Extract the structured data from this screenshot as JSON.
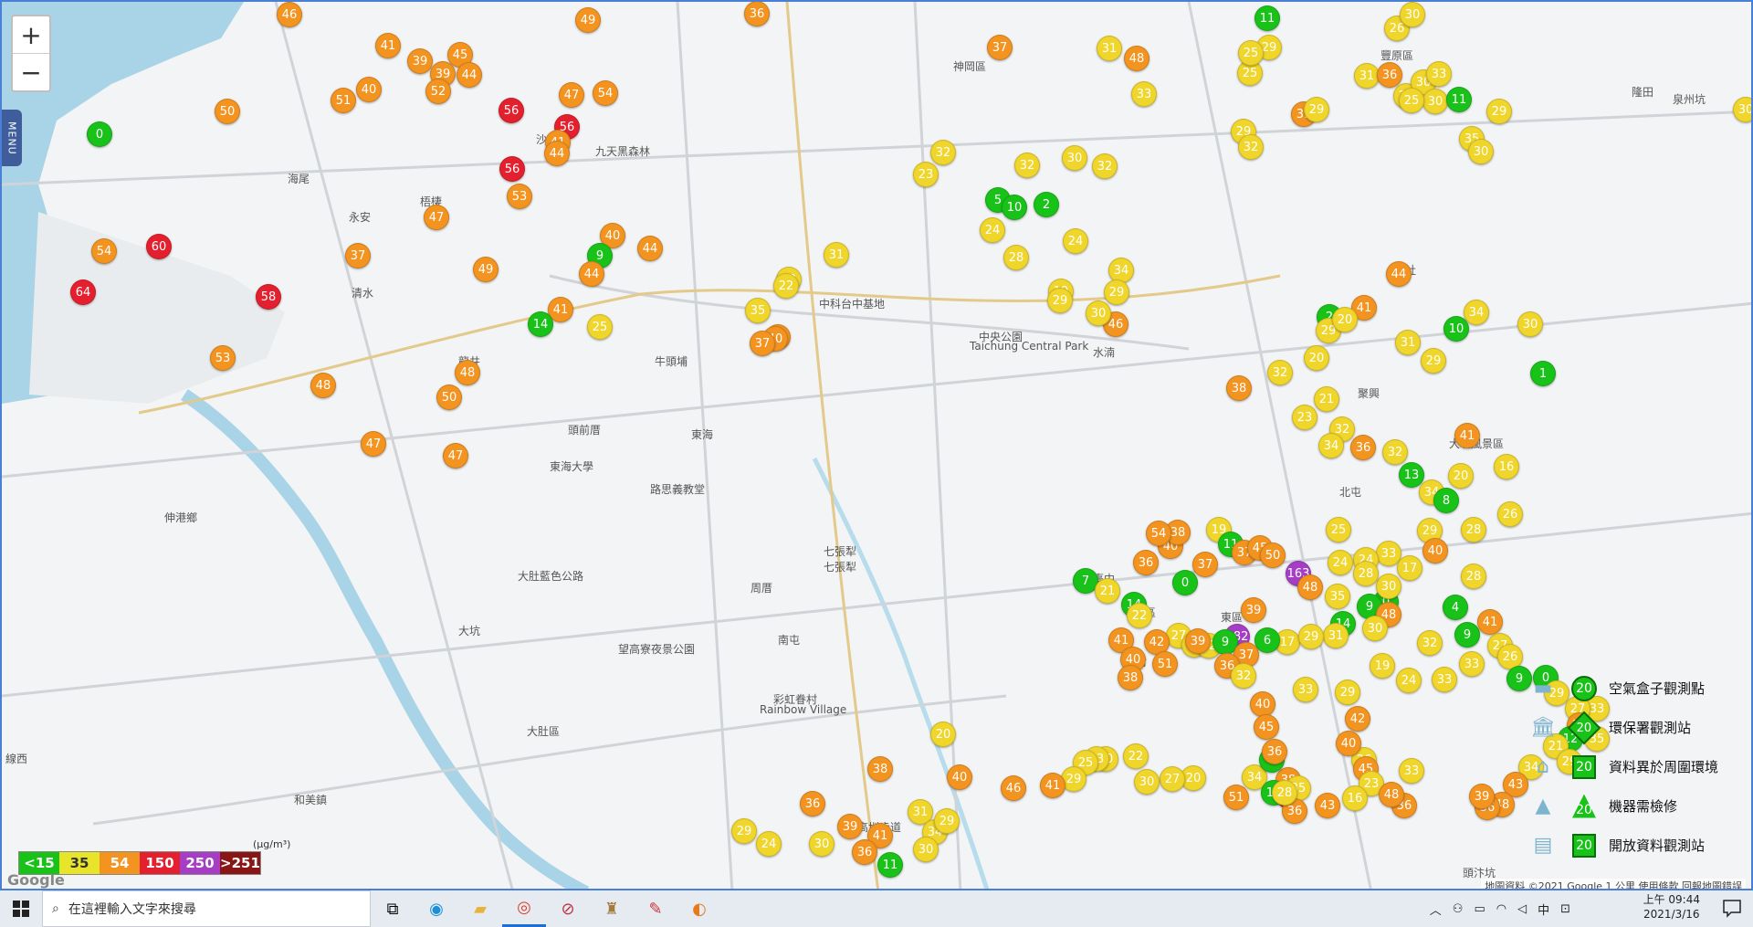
{
  "map": {
    "zoom_in": "+",
    "zoom_out": "−",
    "menu_label": "MENU",
    "places": [
      {
        "name": "沙鹿區"
      },
      {
        "name": "九天黑森林"
      },
      {
        "name": "神岡區"
      },
      {
        "name": "豐原區"
      },
      {
        "name": "梧棲"
      },
      {
        "name": "海尾"
      },
      {
        "name": "永安"
      },
      {
        "name": "清水"
      },
      {
        "name": "龍井"
      },
      {
        "name": "牛頭埔"
      },
      {
        "name": "中科台中基地"
      },
      {
        "name": "中央公園"
      },
      {
        "name": "Taichung Central Park"
      },
      {
        "name": "水湳"
      },
      {
        "name": "北屯"
      },
      {
        "name": "大坑風景區"
      },
      {
        "name": "頭前厝"
      },
      {
        "name": "東海"
      },
      {
        "name": "南屯"
      },
      {
        "name": "路思義教堂"
      },
      {
        "name": "大肚區"
      },
      {
        "name": "伸港鄉"
      },
      {
        "name": "彩虹眷村"
      },
      {
        "name": "Rainbow Village"
      },
      {
        "name": "知高圳步道"
      },
      {
        "name": "望高寮夜景公園"
      },
      {
        "name": "大肚藍色公路"
      },
      {
        "name": "周厝"
      },
      {
        "name": "七張犁"
      },
      {
        "name": "臺中"
      },
      {
        "name": "北區"
      },
      {
        "name": "中市"
      },
      {
        "name": "東區"
      },
      {
        "name": "頭汴坑"
      },
      {
        "name": "線西"
      },
      {
        "name": "和美鎮"
      },
      {
        "name": "大坑"
      },
      {
        "name": "新社"
      },
      {
        "name": "聚興"
      },
      {
        "name": "隆田"
      },
      {
        "name": "泉州坑"
      },
      {
        "name": "東海大學"
      },
      {
        "name": "七張犁"
      }
    ]
  },
  "legend": {
    "scale": [
      {
        "label": "<15",
        "color": "#19c219"
      },
      {
        "label": "35",
        "color": "#e7e42a"
      },
      {
        "label": "54",
        "color": "#f39320"
      },
      {
        "label": "150",
        "color": "#e5202e"
      },
      {
        "label": "250",
        "color": "#a63ec5"
      },
      {
        "label": ">251",
        "color": "#8a1515"
      }
    ],
    "unit": "(μg/m³)",
    "types": [
      {
        "label": "空氣盒子觀測點",
        "shape": "circle",
        "value": "20"
      },
      {
        "label": "環保署觀測站",
        "shape": "diamond",
        "value": "20"
      },
      {
        "label": "資料異於周圍環境",
        "shape": "square",
        "value": "20"
      },
      {
        "label": "機器需檢修",
        "shape": "triangle",
        "value": "20"
      },
      {
        "label": "開放資料觀測站",
        "shape": "square",
        "value": "20"
      }
    ]
  },
  "attribution": "地圖資料 ©2021 Google   1 公里   使用條款   回報地圖錯誤",
  "google_logo": "Google",
  "colors": {
    "green": "#19c219",
    "yellow": "#f0d52b",
    "orange": "#f39320",
    "red": "#e5202e",
    "purple": "#a63ec5",
    "brown": "#8a1515"
  },
  "markers": [
    {
      "v": "46",
      "c": "orange"
    },
    {
      "v": "41",
      "c": "orange"
    },
    {
      "v": "39",
      "c": "orange"
    },
    {
      "v": "45",
      "c": "orange"
    },
    {
      "v": "39",
      "c": "orange"
    },
    {
      "v": "44",
      "c": "orange"
    },
    {
      "v": "49",
      "c": "orange"
    },
    {
      "v": "36",
      "c": "orange"
    },
    {
      "v": "37",
      "c": "orange"
    },
    {
      "v": "48",
      "c": "orange"
    },
    {
      "v": "25",
      "c": "yellow"
    },
    {
      "v": "29",
      "c": "yellow"
    },
    {
      "v": "11",
      "c": "green"
    },
    {
      "v": "26",
      "c": "yellow"
    },
    {
      "v": "30",
      "c": "yellow"
    },
    {
      "v": "51",
      "c": "orange"
    },
    {
      "v": "40",
      "c": "orange"
    },
    {
      "v": "52",
      "c": "orange"
    },
    {
      "v": "50",
      "c": "orange"
    },
    {
      "v": "0",
      "c": "green"
    },
    {
      "v": "56",
      "c": "red"
    },
    {
      "v": "56",
      "c": "red"
    },
    {
      "v": "47",
      "c": "orange"
    },
    {
      "v": "54",
      "c": "orange"
    },
    {
      "v": "41",
      "c": "orange"
    },
    {
      "v": "56",
      "c": "red"
    },
    {
      "v": "53",
      "c": "orange"
    },
    {
      "v": "44",
      "c": "orange"
    },
    {
      "v": "47",
      "c": "orange"
    },
    {
      "v": "54",
      "c": "orange"
    },
    {
      "v": "60",
      "c": "red"
    },
    {
      "v": "37",
      "c": "orange"
    },
    {
      "v": "49",
      "c": "orange"
    },
    {
      "v": "64",
      "c": "red"
    },
    {
      "v": "58",
      "c": "red"
    },
    {
      "v": "53",
      "c": "orange"
    },
    {
      "v": "48",
      "c": "orange"
    },
    {
      "v": "50",
      "c": "orange"
    },
    {
      "v": "48",
      "c": "orange"
    },
    {
      "v": "47",
      "c": "orange"
    },
    {
      "v": "47",
      "c": "orange"
    },
    {
      "v": "41",
      "c": "orange"
    },
    {
      "v": "14",
      "c": "green"
    },
    {
      "v": "25",
      "c": "yellow"
    },
    {
      "v": "40",
      "c": "orange"
    },
    {
      "v": "44",
      "c": "orange"
    },
    {
      "v": "9",
      "c": "green"
    },
    {
      "v": "44",
      "c": "orange"
    },
    {
      "v": "22",
      "c": "yellow"
    },
    {
      "v": "31",
      "c": "yellow"
    },
    {
      "v": "22",
      "c": "yellow"
    },
    {
      "v": "40",
      "c": "orange"
    },
    {
      "v": "35",
      "c": "yellow"
    },
    {
      "v": "40",
      "c": "orange"
    },
    {
      "v": "37",
      "c": "orange"
    },
    {
      "v": "32",
      "c": "yellow"
    },
    {
      "v": "23",
      "c": "yellow"
    },
    {
      "v": "32",
      "c": "yellow"
    },
    {
      "v": "30",
      "c": "yellow"
    },
    {
      "v": "32",
      "c": "yellow"
    },
    {
      "v": "5",
      "c": "green"
    },
    {
      "v": "10",
      "c": "green"
    },
    {
      "v": "2",
      "c": "green"
    },
    {
      "v": "24",
      "c": "yellow"
    },
    {
      "v": "28",
      "c": "yellow"
    },
    {
      "v": "24",
      "c": "yellow"
    },
    {
      "v": "34",
      "c": "yellow"
    },
    {
      "v": "29",
      "c": "yellow"
    },
    {
      "v": "46",
      "c": "orange"
    },
    {
      "v": "19",
      "c": "yellow"
    },
    {
      "v": "29",
      "c": "yellow"
    },
    {
      "v": "30",
      "c": "yellow"
    },
    {
      "v": "31",
      "c": "yellow"
    },
    {
      "v": "33",
      "c": "yellow"
    },
    {
      "v": "25",
      "c": "yellow"
    },
    {
      "v": "29",
      "c": "yellow"
    },
    {
      "v": "32",
      "c": "yellow"
    },
    {
      "v": "39",
      "c": "orange"
    },
    {
      "v": "31",
      "c": "yellow"
    },
    {
      "v": "29",
      "c": "yellow"
    },
    {
      "v": "36",
      "c": "orange"
    },
    {
      "v": "29",
      "c": "yellow"
    },
    {
      "v": "30",
      "c": "yellow"
    },
    {
      "v": "33",
      "c": "yellow"
    },
    {
      "v": "30",
      "c": "yellow"
    },
    {
      "v": "25",
      "c": "yellow"
    },
    {
      "v": "2",
      "c": "green"
    },
    {
      "v": "29",
      "c": "yellow"
    },
    {
      "v": "20",
      "c": "yellow"
    },
    {
      "v": "31",
      "c": "yellow"
    },
    {
      "v": "34",
      "c": "yellow"
    },
    {
      "v": "10",
      "c": "green"
    },
    {
      "v": "30",
      "c": "yellow"
    },
    {
      "v": "30",
      "c": "yellow"
    },
    {
      "v": "35",
      "c": "yellow"
    },
    {
      "v": "30",
      "c": "yellow"
    },
    {
      "v": "29",
      "c": "yellow"
    },
    {
      "v": "11",
      "c": "green"
    },
    {
      "v": "1",
      "c": "green"
    },
    {
      "v": "29",
      "c": "yellow"
    },
    {
      "v": "41",
      "c": "orange"
    },
    {
      "v": "44",
      "c": "orange"
    },
    {
      "v": "41",
      "c": "orange"
    },
    {
      "v": "20",
      "c": "yellow"
    },
    {
      "v": "32",
      "c": "yellow"
    },
    {
      "v": "38",
      "c": "orange"
    },
    {
      "v": "23",
      "c": "yellow"
    },
    {
      "v": "21",
      "c": "yellow"
    },
    {
      "v": "32",
      "c": "yellow"
    },
    {
      "v": "34",
      "c": "yellow"
    },
    {
      "v": "36",
      "c": "orange"
    },
    {
      "v": "32",
      "c": "yellow"
    },
    {
      "v": "13",
      "c": "green"
    },
    {
      "v": "20",
      "c": "yellow"
    },
    {
      "v": "16",
      "c": "yellow"
    },
    {
      "v": "34",
      "c": "yellow"
    },
    {
      "v": "8",
      "c": "green"
    },
    {
      "v": "29",
      "c": "yellow"
    },
    {
      "v": "28",
      "c": "yellow"
    },
    {
      "v": "26",
      "c": "yellow"
    },
    {
      "v": "33",
      "c": "yellow"
    },
    {
      "v": "40",
      "c": "orange"
    },
    {
      "v": "17",
      "c": "yellow"
    },
    {
      "v": "0",
      "c": "green"
    },
    {
      "v": "28",
      "c": "yellow"
    },
    {
      "v": "30",
      "c": "yellow"
    },
    {
      "v": "25",
      "c": "yellow"
    },
    {
      "v": "24",
      "c": "yellow"
    },
    {
      "v": "28",
      "c": "yellow"
    },
    {
      "v": "9",
      "c": "green"
    },
    {
      "v": "48",
      "c": "orange"
    },
    {
      "v": "35",
      "c": "yellow"
    },
    {
      "v": "14",
      "c": "green"
    },
    {
      "v": "31",
      "c": "yellow"
    },
    {
      "v": "30",
      "c": "yellow"
    },
    {
      "v": "17",
      "c": "yellow"
    },
    {
      "v": "19",
      "c": "yellow"
    },
    {
      "v": "24",
      "c": "yellow"
    },
    {
      "v": "33",
      "c": "yellow"
    },
    {
      "v": "9",
      "c": "green"
    },
    {
      "v": "41",
      "c": "orange"
    },
    {
      "v": "27",
      "c": "yellow"
    },
    {
      "v": "33",
      "c": "yellow"
    },
    {
      "v": "32",
      "c": "yellow"
    },
    {
      "v": "4",
      "c": "green"
    },
    {
      "v": "26",
      "c": "yellow"
    },
    {
      "v": "9",
      "c": "green"
    },
    {
      "v": "0",
      "c": "green"
    },
    {
      "v": "29",
      "c": "yellow"
    },
    {
      "v": "33",
      "c": "yellow"
    },
    {
      "v": "27",
      "c": "yellow"
    },
    {
      "v": "38",
      "c": "orange"
    },
    {
      "v": "12",
      "c": "green"
    },
    {
      "v": "21",
      "c": "yellow"
    },
    {
      "v": "35",
      "c": "yellow"
    },
    {
      "v": "29",
      "c": "yellow"
    },
    {
      "v": "34",
      "c": "yellow"
    },
    {
      "v": "43",
      "c": "orange"
    },
    {
      "v": "48",
      "c": "orange"
    },
    {
      "v": "36",
      "c": "orange"
    },
    {
      "v": "39",
      "c": "orange"
    },
    {
      "v": "36",
      "c": "orange"
    },
    {
      "v": "33",
      "c": "yellow"
    },
    {
      "v": "26",
      "c": "yellow"
    },
    {
      "v": "60",
      "c": "red"
    },
    {
      "v": "38",
      "c": "orange"
    },
    {
      "v": "34",
      "c": "yellow"
    },
    {
      "v": "8",
      "c": "green"
    },
    {
      "v": "7",
      "c": "green"
    },
    {
      "v": "21",
      "c": "yellow"
    },
    {
      "v": "14",
      "c": "green"
    },
    {
      "v": "22",
      "c": "yellow"
    },
    {
      "v": "27",
      "c": "yellow"
    },
    {
      "v": "16",
      "c": "yellow"
    },
    {
      "v": "32",
      "c": "yellow"
    },
    {
      "v": "182",
      "c": "purple"
    },
    {
      "v": "6",
      "c": "green"
    },
    {
      "v": "9",
      "c": "green"
    },
    {
      "v": "37",
      "c": "orange"
    },
    {
      "v": "36",
      "c": "orange"
    },
    {
      "v": "32",
      "c": "yellow"
    },
    {
      "v": "40",
      "c": "orange"
    },
    {
      "v": "45",
      "c": "orange"
    },
    {
      "v": "36",
      "c": "orange"
    },
    {
      "v": "13",
      "c": "green"
    },
    {
      "v": "39",
      "c": "orange"
    },
    {
      "v": "42",
      "c": "orange"
    },
    {
      "v": "41",
      "c": "orange"
    },
    {
      "v": "40",
      "c": "orange"
    },
    {
      "v": "30",
      "c": "yellow"
    },
    {
      "v": "51",
      "c": "orange"
    },
    {
      "v": "38",
      "c": "orange"
    },
    {
      "v": "39",
      "c": "orange"
    },
    {
      "v": "0",
      "c": "green"
    },
    {
      "v": "37",
      "c": "orange"
    },
    {
      "v": "40",
      "c": "orange"
    },
    {
      "v": "36",
      "c": "orange"
    },
    {
      "v": "38",
      "c": "orange"
    },
    {
      "v": "54",
      "c": "orange"
    },
    {
      "v": "19",
      "c": "yellow"
    },
    {
      "v": "11",
      "c": "green"
    },
    {
      "v": "37",
      "c": "orange"
    },
    {
      "v": "45",
      "c": "orange"
    },
    {
      "v": "50",
      "c": "orange"
    },
    {
      "v": "163",
      "c": "purple"
    },
    {
      "v": "48",
      "c": "orange"
    },
    {
      "v": "24",
      "c": "yellow"
    },
    {
      "v": "29",
      "c": "yellow"
    },
    {
      "v": "33",
      "c": "yellow"
    },
    {
      "v": "29",
      "c": "yellow"
    },
    {
      "v": "42",
      "c": "orange"
    },
    {
      "v": "40",
      "c": "orange"
    },
    {
      "v": "45",
      "c": "orange"
    },
    {
      "v": "23",
      "c": "yellow"
    },
    {
      "v": "16",
      "c": "yellow"
    },
    {
      "v": "48",
      "c": "orange"
    },
    {
      "v": "35",
      "c": "yellow"
    },
    {
      "v": "36",
      "c": "orange"
    },
    {
      "v": "43",
      "c": "orange"
    },
    {
      "v": "28",
      "c": "yellow"
    },
    {
      "v": "51",
      "c": "orange"
    },
    {
      "v": "20",
      "c": "yellow"
    },
    {
      "v": "27",
      "c": "yellow"
    },
    {
      "v": "30",
      "c": "yellow"
    },
    {
      "v": "22",
      "c": "yellow"
    },
    {
      "v": "33",
      "c": "yellow"
    },
    {
      "v": "25",
      "c": "yellow"
    },
    {
      "v": "29",
      "c": "yellow"
    },
    {
      "v": "41",
      "c": "orange"
    },
    {
      "v": "46",
      "c": "orange"
    },
    {
      "v": "40",
      "c": "orange"
    },
    {
      "v": "20",
      "c": "yellow"
    },
    {
      "v": "38",
      "c": "orange"
    },
    {
      "v": "41",
      "c": "orange"
    },
    {
      "v": "39",
      "c": "orange"
    },
    {
      "v": "36",
      "c": "orange"
    },
    {
      "v": "30",
      "c": "yellow"
    },
    {
      "v": "24",
      "c": "yellow"
    },
    {
      "v": "29",
      "c": "yellow"
    },
    {
      "v": "36",
      "c": "orange"
    },
    {
      "v": "31",
      "c": "yellow"
    },
    {
      "v": "34",
      "c": "yellow"
    },
    {
      "v": "30",
      "c": "yellow"
    },
    {
      "v": "11",
      "c": "green"
    },
    {
      "v": "29",
      "c": "yellow"
    }
  ],
  "taskbar": {
    "search_placeholder": "在這裡輸入文字來搜尋",
    "tray_lang": "中",
    "time": "上午 09:44",
    "date": "2021/3/16"
  }
}
